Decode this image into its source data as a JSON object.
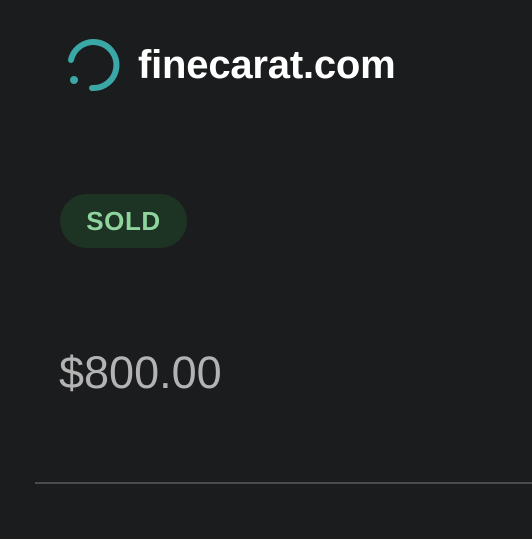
{
  "header": {
    "logo_icon": "circular-progress-logo-icon",
    "site_name": "finecarat.com"
  },
  "listing": {
    "status": "SOLD",
    "price": "$800.00"
  },
  "colors": {
    "background": "#1b1c1e",
    "logo_accent": "#3aa8a6",
    "badge_background": "#1d3323",
    "badge_text": "#8fd39d",
    "price_text": "#b3b3b3",
    "divider": "#4a4b4e"
  }
}
